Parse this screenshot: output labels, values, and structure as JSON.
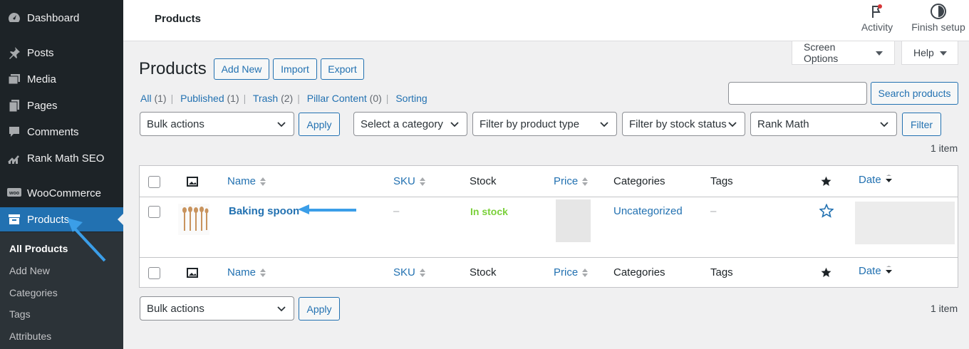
{
  "sidebar": {
    "items": [
      {
        "label": "Dashboard",
        "icon": "dashboard-icon"
      },
      {
        "label": "Posts",
        "icon": "pin-icon"
      },
      {
        "label": "Media",
        "icon": "media-icon"
      },
      {
        "label": "Pages",
        "icon": "pages-icon"
      },
      {
        "label": "Comments",
        "icon": "comments-icon"
      },
      {
        "label": "Rank Math SEO",
        "icon": "rank-math-icon"
      },
      {
        "label": "WooCommerce",
        "icon": "woo-icon"
      },
      {
        "label": "Products",
        "icon": "archive-icon"
      }
    ],
    "submenu": [
      "All Products",
      "Add New",
      "Categories",
      "Tags",
      "Attributes"
    ]
  },
  "topbar": {
    "title": "Products",
    "activity": "Activity",
    "finish_setup": "Finish setup"
  },
  "screen_options": "Screen Options",
  "help": "Help",
  "page": {
    "title": "Products",
    "add_new": "Add New",
    "import": "Import",
    "export": "Export"
  },
  "views": [
    {
      "label": "All",
      "count": "(1)"
    },
    {
      "label": "Published",
      "count": "(1)"
    },
    {
      "label": "Trash",
      "count": "(2)"
    },
    {
      "label": "Pillar Content",
      "count": "(0)"
    },
    {
      "label": "Sorting",
      "count": ""
    }
  ],
  "search_button": "Search products",
  "filters": {
    "bulk_actions": "Bulk actions",
    "apply": "Apply",
    "category": "Select a category",
    "product_type": "Filter by product type",
    "stock_status": "Filter by stock status",
    "rank_math": "Rank Math",
    "filter": "Filter"
  },
  "item_count": "1 item",
  "table": {
    "columns": {
      "name": "Name",
      "sku": "SKU",
      "stock": "Stock",
      "price": "Price",
      "categories": "Categories",
      "tags": "Tags",
      "date": "Date"
    },
    "rows": [
      {
        "name": "Baking spoon",
        "sku": "–",
        "stock": "In stock",
        "categories": "Uncategorized",
        "tags": "–"
      }
    ]
  },
  "colors": {
    "accent": "#2271b1",
    "sidebar": "#1d2327",
    "in_stock": "#7ad03a",
    "annotation_arrow": "#3b9ee8"
  }
}
